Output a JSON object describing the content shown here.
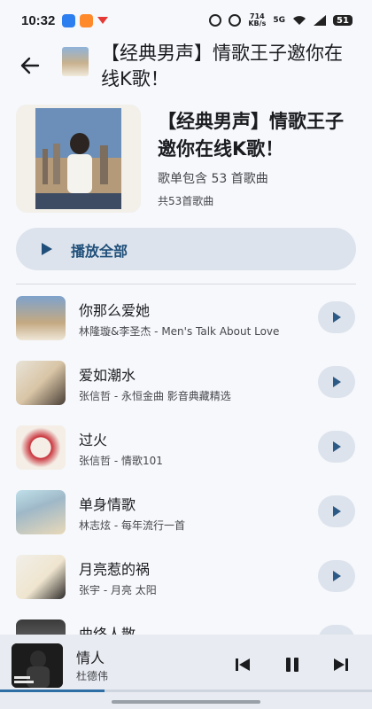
{
  "status_bar": {
    "time": "10:32",
    "speed_top": "714",
    "speed_bottom": "KB/s",
    "network": "5G",
    "battery": "51"
  },
  "header": {
    "title": "【经典男声】情歌王子邀你在线K歌！"
  },
  "playlist": {
    "title": "【经典男声】情歌王子邀你在线K歌！",
    "subtitle": "歌单包含 53 首歌曲",
    "count_text": "共53首歌曲",
    "play_all_label": "播放全部"
  },
  "songs": [
    {
      "title": "你那么爱她",
      "subtitle": "林隆璇&李圣杰 - Men's Talk About Love"
    },
    {
      "title": "爱如潮水",
      "subtitle": "张信哲 - 永恒金曲 影音典藏精选"
    },
    {
      "title": "过火",
      "subtitle": "张信哲 - 情歌101"
    },
    {
      "title": "单身情歌",
      "subtitle": "林志炫 - 每年流行一首"
    },
    {
      "title": "月亮惹的祸",
      "subtitle": "张宇 - 月亮 太阳"
    },
    {
      "title": "曲终人散",
      "subtitle": ""
    }
  ],
  "player": {
    "title": "情人",
    "artist": "杜德伟",
    "progress": 0.28
  },
  "colors": {
    "accent": "#1f4f7a",
    "surface": "#dde3ec",
    "background": "#f6f8fc"
  }
}
